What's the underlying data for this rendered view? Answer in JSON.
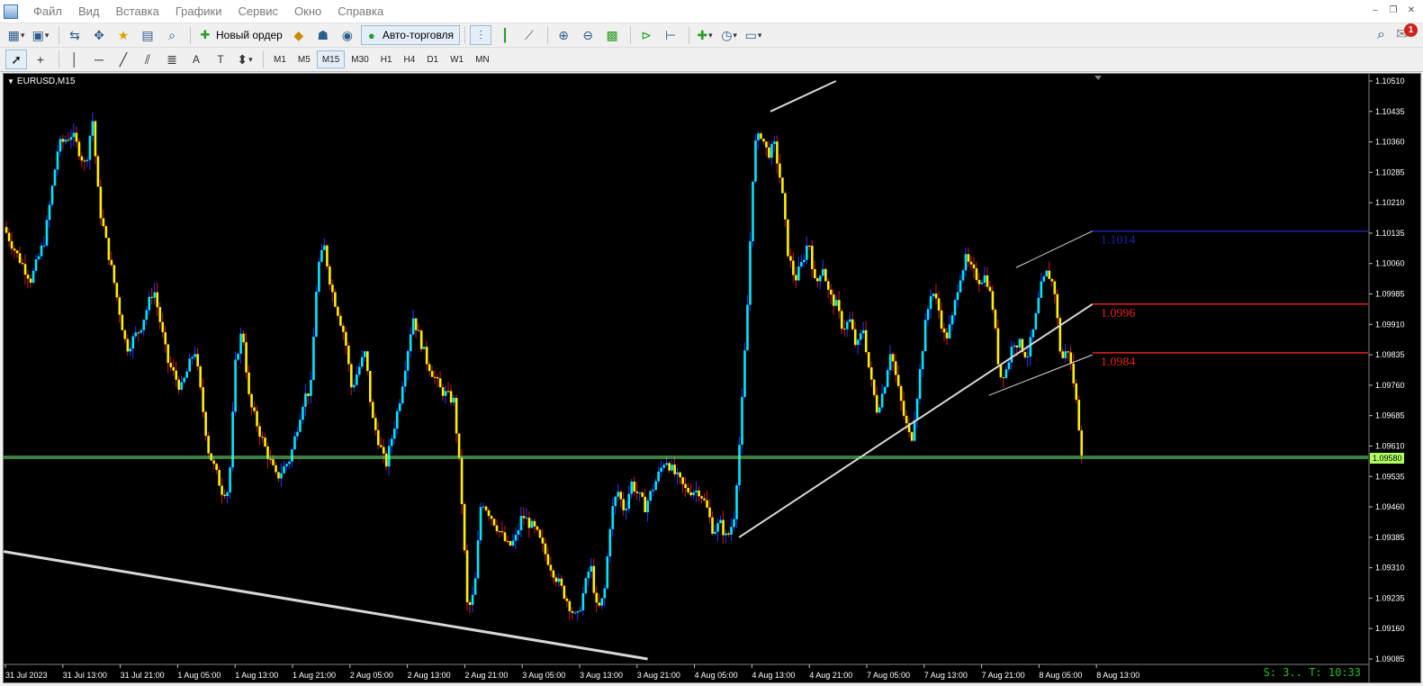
{
  "menu": {
    "items": [
      "Файл",
      "Вид",
      "Вставка",
      "Графики",
      "Сервис",
      "Окно",
      "Справка"
    ]
  },
  "toolbar": {
    "new_order_label": "Новый ордер",
    "autotrade_label": "Авто-торговля",
    "notification_count": "1",
    "timeframes": [
      "M1",
      "M5",
      "M15",
      "M30",
      "H1",
      "H4",
      "D1",
      "W1",
      "MN"
    ],
    "active_timeframe": "M15"
  },
  "chart": {
    "title": "EURUSD,M15",
    "current_price_label": "1.09580",
    "status_text": "S: 3.. T: 10:33"
  },
  "chart_data": {
    "type": "candlestick",
    "symbol": "EURUSD",
    "timeframe": "M15",
    "ylim": [
      1.0916,
      1.1055
    ],
    "y_ticks": [
      "1.10510",
      "1.10435",
      "1.10360",
      "1.10285",
      "1.10210",
      "1.10135",
      "1.10060",
      "1.09985",
      "1.09910",
      "1.09835",
      "1.09760",
      "1.09685",
      "1.09610",
      "1.09535",
      "1.09460",
      "1.09385",
      "1.09310",
      "1.09235",
      "1.09160",
      "1.09085"
    ],
    "x_ticks": [
      "31 Jul 2023",
      "31 Jul 13:00",
      "31 Jul 21:00",
      "1 Aug 05:00",
      "1 Aug 13:00",
      "1 Aug 21:00",
      "2 Aug 05:00",
      "2 Aug 13:00",
      "2 Aug 21:00",
      "3 Aug 05:00",
      "3 Aug 13:00",
      "3 Aug 21:00",
      "4 Aug 05:00",
      "4 Aug 13:00",
      "4 Aug 21:00",
      "7 Aug 05:00",
      "7 Aug 13:00",
      "7 Aug 21:00",
      "8 Aug 05:00",
      "8 Aug 13:00"
    ],
    "price_path": [
      [
        0,
        1.1015
      ],
      [
        0.01,
        1.1008
      ],
      [
        0.02,
        1.1002
      ],
      [
        0.03,
        1.1012
      ],
      [
        0.04,
        1.1035
      ],
      [
        0.05,
        1.1038
      ],
      [
        0.06,
        1.103
      ],
      [
        0.065,
        1.1042
      ],
      [
        0.07,
        1.102
      ],
      [
        0.08,
        1.1003
      ],
      [
        0.09,
        1.0985
      ],
      [
        0.1,
        1.099
      ],
      [
        0.11,
        1.1
      ],
      [
        0.12,
        1.0982
      ],
      [
        0.13,
        1.0975
      ],
      [
        0.14,
        1.0985
      ],
      [
        0.15,
        1.096
      ],
      [
        0.16,
        1.095
      ],
      [
        0.165,
        1.095
      ],
      [
        0.17,
        1.0982
      ],
      [
        0.175,
        1.099
      ],
      [
        0.18,
        1.0972
      ],
      [
        0.19,
        1.0962
      ],
      [
        0.2,
        1.0953
      ],
      [
        0.21,
        1.0958
      ],
      [
        0.22,
        1.0973
      ],
      [
        0.225,
        1.0975
      ],
      [
        0.23,
        1.1005
      ],
      [
        0.235,
        1.101
      ],
      [
        0.24,
        1.1
      ],
      [
        0.25,
        1.0988
      ],
      [
        0.255,
        1.0975
      ],
      [
        0.26,
        1.098
      ],
      [
        0.265,
        1.0984
      ],
      [
        0.27,
        1.0968
      ],
      [
        0.28,
        1.0956
      ],
      [
        0.29,
        1.0972
      ],
      [
        0.3,
        1.0993
      ],
      [
        0.31,
        1.0982
      ],
      [
        0.32,
        1.0975
      ],
      [
        0.33,
        1.0972
      ],
      [
        0.335,
        1.0952
      ],
      [
        0.34,
        1.092
      ],
      [
        0.345,
        1.0925
      ],
      [
        0.35,
        1.0948
      ],
      [
        0.36,
        1.0942
      ],
      [
        0.37,
        1.0936
      ],
      [
        0.375,
        1.0938
      ],
      [
        0.38,
        1.0944
      ],
      [
        0.39,
        1.094
      ],
      [
        0.4,
        1.0932
      ],
      [
        0.41,
        1.0925
      ],
      [
        0.42,
        1.0918
      ],
      [
        0.425,
        1.0925
      ],
      [
        0.43,
        1.0932
      ],
      [
        0.435,
        1.092
      ],
      [
        0.44,
        1.0924
      ],
      [
        0.445,
        1.0944
      ],
      [
        0.45,
        1.095
      ],
      [
        0.455,
        1.0945
      ],
      [
        0.46,
        1.0952
      ],
      [
        0.47,
        1.0946
      ],
      [
        0.48,
        1.0954
      ],
      [
        0.485,
        1.0958
      ],
      [
        0.49,
        1.0955
      ],
      [
        0.5,
        1.095
      ],
      [
        0.51,
        1.095
      ],
      [
        0.515,
        1.0946
      ],
      [
        0.52,
        1.094
      ],
      [
        0.525,
        1.0942
      ],
      [
        0.53,
        1.0938
      ],
      [
        0.535,
        1.0943
      ],
      [
        0.54,
        1.0965
      ],
      [
        0.545,
        1.0995
      ],
      [
        0.55,
        1.1035
      ],
      [
        0.555,
        1.1038
      ],
      [
        0.56,
        1.1033
      ],
      [
        0.565,
        1.1035
      ],
      [
        0.57,
        1.1025
      ],
      [
        0.575,
        1.1008
      ],
      [
        0.58,
        1.1002
      ],
      [
        0.585,
        1.1006
      ],
      [
        0.59,
        1.1012
      ],
      [
        0.595,
        1.1
      ],
      [
        0.6,
        1.1006
      ],
      [
        0.605,
        1.0998
      ],
      [
        0.61,
        1.0996
      ],
      [
        0.615,
        1.099
      ],
      [
        0.62,
        1.0992
      ],
      [
        0.625,
        1.0985
      ],
      [
        0.63,
        1.099
      ],
      [
        0.635,
        1.0978
      ],
      [
        0.64,
        1.097
      ],
      [
        0.645,
        1.0975
      ],
      [
        0.65,
        1.0985
      ],
      [
        0.655,
        1.0976
      ],
      [
        0.66,
        1.0968
      ],
      [
        0.665,
        1.0962
      ],
      [
        0.67,
        1.0975
      ],
      [
        0.675,
        1.099
      ],
      [
        0.68,
        1.1
      ],
      [
        0.685,
        1.0995
      ],
      [
        0.69,
        1.0987
      ],
      [
        0.695,
        1.0992
      ],
      [
        0.7,
        1.1002
      ],
      [
        0.705,
        1.1007
      ],
      [
        0.71,
        1.1004
      ],
      [
        0.715,
        1.1002
      ],
      [
        0.72,
        1.1003
      ],
      [
        0.725,
        1.0995
      ],
      [
        0.73,
        1.0978
      ],
      [
        0.735,
        1.098
      ],
      [
        0.74,
        1.0987
      ],
      [
        0.745,
        1.0986
      ],
      [
        0.75,
        1.0983
      ],
      [
        0.755,
        1.099
      ],
      [
        0.76,
        1.1
      ],
      [
        0.765,
        1.1004
      ],
      [
        0.77,
        1.1
      ],
      [
        0.775,
        1.0982
      ],
      [
        0.78,
        1.0985
      ],
      [
        0.785,
        1.0975
      ],
      [
        0.79,
        1.096
      ]
    ],
    "horizontal_lines": [
      {
        "label": "1.1014",
        "price": 1.1014,
        "color": "#1c24a8"
      },
      {
        "label": "1.0996",
        "price": 1.0996,
        "color": "#e02020"
      },
      {
        "label": "1.0984",
        "price": 1.0984,
        "color": "#e02020"
      },
      {
        "label": "",
        "price": 1.0958,
        "color": "#7cfc7c"
      }
    ],
    "colors": {
      "background": "#000000",
      "bull": "#00e5ff",
      "bear": "#ffee00",
      "wick_up": "#1f3cff",
      "wick_down": "#cc1a1a",
      "trendline": "#d8d8d8",
      "axis_text": "#ffffff",
      "price_marker": "#b0ff60"
    }
  },
  "icons": {
    "toolbar1": [
      "new-chart-icon",
      "profiles-icon",
      "market-watch-icon",
      "navigator-icon",
      "favorites-icon",
      "data-window-icon",
      "terminal-icon",
      "new-order-icon",
      "market-icon",
      "strategy-tester-icon",
      "signals-icon",
      "autotrade-icon",
      "bar-chart-icon",
      "candles-icon",
      "line-chart-icon",
      "zoom-in-icon",
      "zoom-out-icon",
      "tile-windows-icon",
      "autoscroll-icon",
      "chart-shift-icon",
      "indicators-icon",
      "periods-icon",
      "templates-icon",
      "search-icon",
      "notifications-icon"
    ],
    "toolbar2": [
      "cursor-icon",
      "crosshair-icon",
      "vertical-line-icon",
      "horizontal-line-icon",
      "trendline-icon",
      "equidistant-channel-icon",
      "fibonacci-icon",
      "text-icon",
      "text-label-icon",
      "arrows-icon"
    ]
  }
}
